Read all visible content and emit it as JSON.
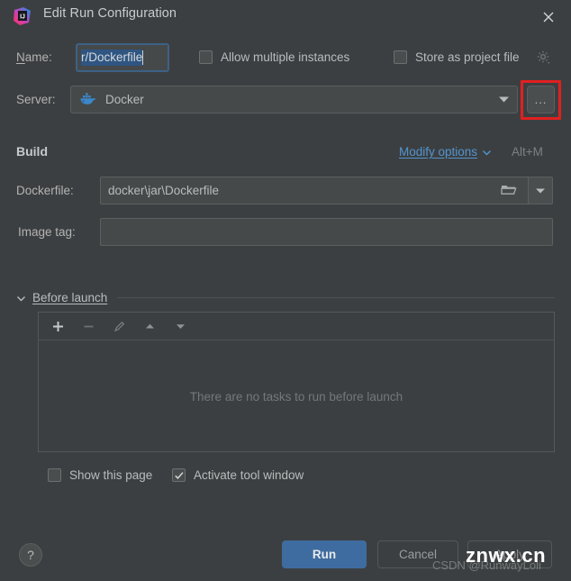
{
  "window": {
    "title": "Edit Run Configuration",
    "app_icon": "intellij-idea-icon",
    "close_icon": "close-icon"
  },
  "name_row": {
    "label": "Name:",
    "value": "r/Dockerfile",
    "allow_multiple": {
      "label": "Allow multiple instances",
      "checked": false
    },
    "store_as_project_file": {
      "label": "Store as project file",
      "checked": false
    },
    "gear_icon": "gear-icon"
  },
  "server_row": {
    "label": "Server:",
    "value": "Docker",
    "icon": "docker-whale-icon",
    "dropdown_icon": "chevron-down-icon",
    "browse_button_label": "...",
    "highlight_color": "#e02020"
  },
  "build": {
    "title": "Build",
    "modify_options_label": "Modify options",
    "modify_options_shortcut": "Alt+M",
    "modify_options_color": "#5294cf",
    "dockerfile": {
      "label": "Dockerfile:",
      "value": "docker\\jar\\Dockerfile",
      "folder_icon": "folder-icon",
      "dropdown_icon": "chevron-down-icon"
    },
    "image_tag": {
      "label": "Image tag:",
      "value": "",
      "placeholder": ""
    }
  },
  "before_launch": {
    "title": "Before launch",
    "expanded": true,
    "toolbar": [
      {
        "name": "add-task-button",
        "glyph": "+",
        "enabled": true
      },
      {
        "name": "remove-task-button",
        "glyph": "−",
        "enabled": false
      },
      {
        "name": "edit-task-button",
        "glyph": "pencil-icon",
        "enabled": false
      },
      {
        "name": "move-up-button",
        "glyph": "triangle-up-icon",
        "enabled": true
      },
      {
        "name": "move-down-button",
        "glyph": "triangle-down-icon",
        "enabled": true
      }
    ],
    "empty_message": "There are no tasks to run before launch"
  },
  "options": {
    "show_this_page": {
      "label": "Show this page",
      "checked": false
    },
    "activate_tool_window": {
      "label": "Activate tool window",
      "checked": true
    }
  },
  "footer": {
    "help_label": "?",
    "run_label": "Run",
    "cancel_label": "Cancel",
    "apply_label": "Apply",
    "run_color": "#3f6ca0"
  },
  "watermarks": {
    "csdn": "CSDN @RunwayLoli",
    "site": "znwx.cn"
  }
}
